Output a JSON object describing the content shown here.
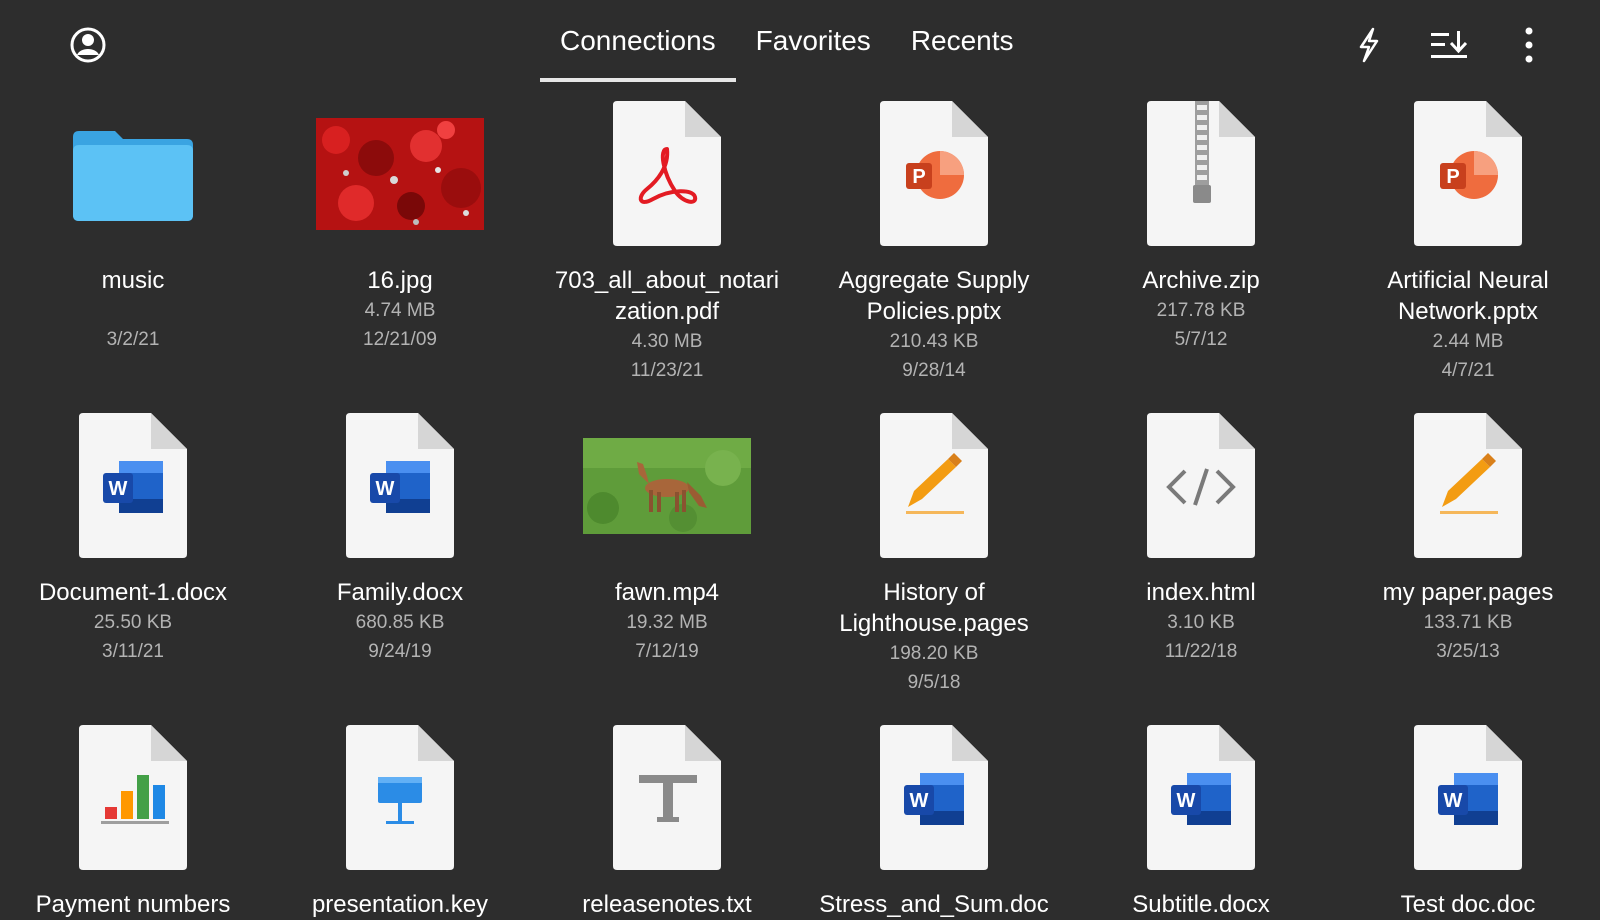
{
  "tabs": [
    {
      "label": "Connections",
      "active": true
    },
    {
      "label": "Favorites",
      "active": false
    },
    {
      "label": "Recents",
      "active": false
    }
  ],
  "toolbar_icons": [
    "account-icon",
    "flash-icon",
    "sort-icon",
    "more-vert-icon"
  ],
  "colors": {
    "background": "#2d2d2d",
    "folder": "#4fb8f0",
    "pdf": "#e31b23",
    "powerpoint": "#d24726",
    "word": "#1b5ebe",
    "pages": "#f39c12",
    "keynote": "#2b8ce6"
  },
  "files": [
    {
      "name": "music",
      "size": "",
      "date": "3/2/21",
      "icon": "folder-icon"
    },
    {
      "name": "16.jpg",
      "size": "4.74 MB",
      "date": "12/21/09",
      "icon": "red-foliage-photo"
    },
    {
      "name": "703_all_about_notari\nzation.pdf",
      "size": "4.30 MB",
      "date": "11/23/21",
      "icon": "pdf-icon"
    },
    {
      "name": "Aggregate Supply\nPolicies.pptx",
      "size": "210.43 KB",
      "date": "9/28/14",
      "icon": "powerpoint-icon"
    },
    {
      "name": "Archive.zip",
      "size": "217.78 KB",
      "date": "5/7/12",
      "icon": "zip-icon"
    },
    {
      "name": "Artificial Neural\nNetwork.pptx",
      "size": "2.44 MB",
      "date": "4/7/21",
      "icon": "powerpoint-icon"
    },
    {
      "name": "Document-1.docx",
      "size": "25.50 KB",
      "date": "3/11/21",
      "icon": "word-icon"
    },
    {
      "name": "Family.docx",
      "size": "680.85 KB",
      "date": "9/24/19",
      "icon": "word-icon"
    },
    {
      "name": "fawn.mp4",
      "size": "19.32 MB",
      "date": "7/12/19",
      "icon": "fawn-video-thumbnail"
    },
    {
      "name": "History of\nLighthouse.pages",
      "size": "198.20 KB",
      "date": "9/5/18",
      "icon": "pages-icon"
    },
    {
      "name": "index.html",
      "size": "3.10 KB",
      "date": "11/22/18",
      "icon": "code-icon"
    },
    {
      "name": "my paper.pages",
      "size": "133.71 KB",
      "date": "3/25/13",
      "icon": "pages-icon"
    },
    {
      "name": "Payment numbers",
      "size": "",
      "date": "",
      "icon": "numbers-icon"
    },
    {
      "name": "presentation.key",
      "size": "",
      "date": "",
      "icon": "keynote-icon"
    },
    {
      "name": "releasenotes.txt",
      "size": "",
      "date": "",
      "icon": "text-icon"
    },
    {
      "name": "Stress_and_Sum.doc",
      "size": "",
      "date": "",
      "icon": "word-icon"
    },
    {
      "name": "Subtitle.docx",
      "size": "",
      "date": "",
      "icon": "word-icon"
    },
    {
      "name": "Test doc.doc",
      "size": "",
      "date": "",
      "icon": "word-icon"
    }
  ]
}
